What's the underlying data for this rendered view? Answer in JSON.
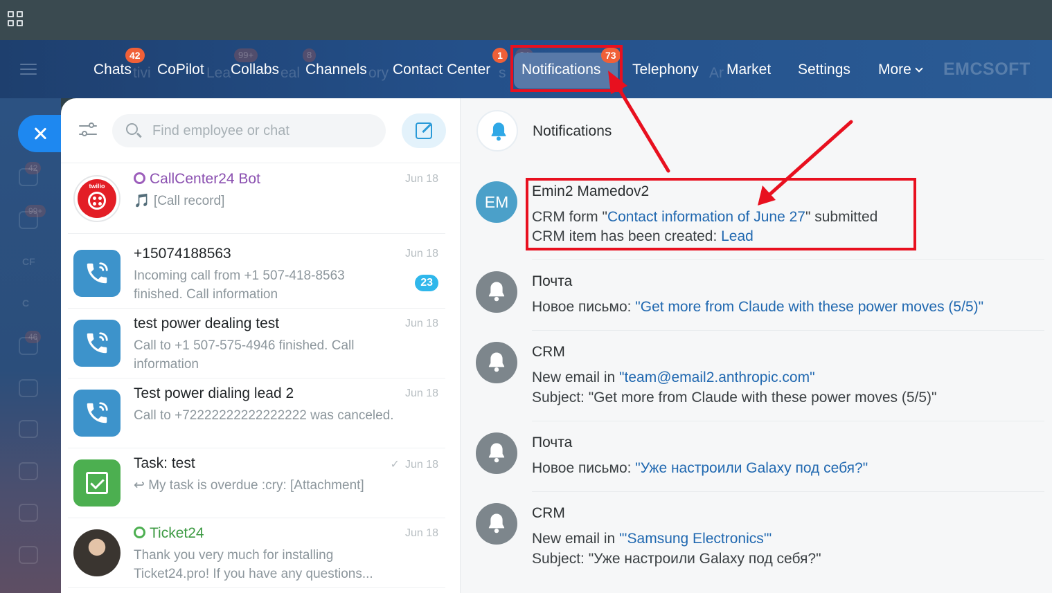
{
  "nav": {
    "items": [
      {
        "label": "Chats",
        "badge": "42"
      },
      {
        "label": "CoPilot"
      },
      {
        "label": "Collabs"
      },
      {
        "label": "Channels"
      },
      {
        "label": "Contact Center",
        "badge": "1"
      },
      {
        "label": "Notifications",
        "badge": "73"
      },
      {
        "label": "Telephony"
      },
      {
        "label": "Market"
      },
      {
        "label": "Settings"
      },
      {
        "label": "More"
      }
    ],
    "brand": "EMCSOFT",
    "ghost_badges": [
      "99+",
      "8",
      "24"
    ],
    "ghost_words": [
      "tivi",
      "Lea",
      "eal",
      "ory",
      "s",
      "Ar"
    ]
  },
  "rail": {
    "badges": [
      "42",
      "99+",
      "46"
    ],
    "labels": [
      "CF",
      "C"
    ]
  },
  "chat_panel": {
    "search_placeholder": "Find employee or chat",
    "chats": [
      {
        "title": "CallCenter24 Bot",
        "sub": "🎵 [Call record]",
        "date": "Jun 18",
        "avatar_text": "twilio",
        "avatar_small": "CallCenter24"
      },
      {
        "title": "+15074188563",
        "sub": "Incoming call from +1 507-418-8563 finished. Call information",
        "date": "Jun 18",
        "counter": "23"
      },
      {
        "title": "test power dealing test",
        "sub": "Call to +1 507-575-4946 finished. Call information",
        "date": "Jun 18"
      },
      {
        "title": "Test power dialing lead 2",
        "sub": "Call to +72222222222222222 was canceled.",
        "date": "Jun 18"
      },
      {
        "title": "Task: test",
        "sub": "↩ My task is overdue :cry: [Attachment]",
        "date": "Jun 18",
        "check": "✓"
      },
      {
        "title": "Ticket24",
        "sub": "Thank you very much for installing Ticket24.pro! If you have any questions...",
        "date": "Jun 18"
      }
    ]
  },
  "notifications": {
    "title": "Notifications",
    "items": [
      {
        "avatar": "EM",
        "author": "Emin2 Mamedov2",
        "line1_pre": "CRM form \"",
        "line1_link": "Contact information of June 27",
        "line1_post": "\" submitted",
        "line2_pre": "CRM item has been created: ",
        "line2_link": "Lead"
      },
      {
        "author": "Почта",
        "line1_pre": "Новое письмо: ",
        "line1_link": "\"Get more from Claude with these power moves (5/5)\""
      },
      {
        "author": "CRM",
        "line1_pre": "New email in ",
        "line1_link": "\"team@email2.anthropic.com\"",
        "line2": "Subject: \"Get more from Claude with these power moves (5/5)\""
      },
      {
        "author": "Почта",
        "line1_pre": "Новое письмо: ",
        "line1_link": "\"Уже настроили Galaxy под себя?\""
      },
      {
        "author": "CRM",
        "line1_pre": "New email in ",
        "line1_link": "\"'Samsung Electronics'\"",
        "line2": "Subject: \"Уже настроили Galaxy под себя?\""
      }
    ]
  },
  "colors": {
    "annotation": "#e8101f",
    "link": "#2068b0",
    "badge": "#f06038",
    "nav_bg": "#24508a"
  }
}
